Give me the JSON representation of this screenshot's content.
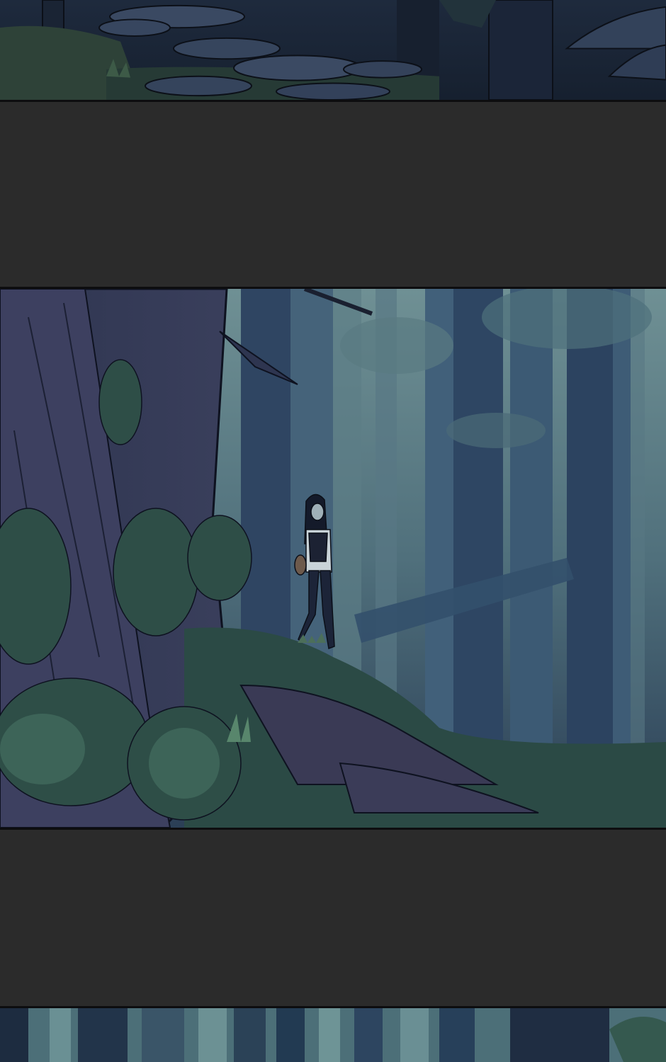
{
  "comic": {
    "panels": [
      {
        "scene": "forest-floor-with-rocks"
      },
      {
        "scene": "misty-forest-figure-on-hillside"
      },
      {
        "scene": "forest-tree-trunks"
      }
    ]
  },
  "colors": {
    "gutter": "#2b2b2b",
    "panel_border": "#0d0d0f",
    "mist": "#5b7a82",
    "deep_forest": "#1a2535",
    "moss": "#2f4a3e",
    "tree_trunk": "#2c3650"
  }
}
